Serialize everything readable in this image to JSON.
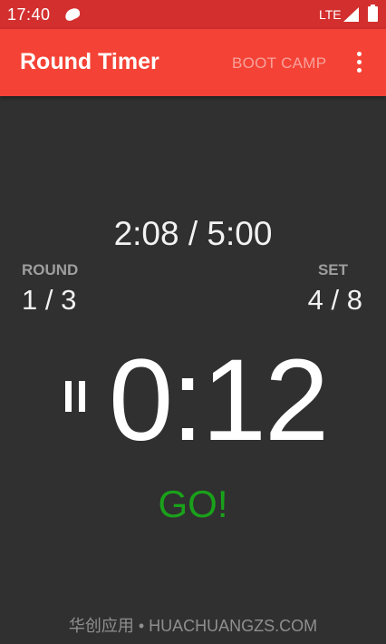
{
  "status_bar": {
    "time": "17:40",
    "network": "LTE",
    "icons": [
      "blob-icon",
      "signal-icon",
      "battery-icon"
    ],
    "background_color": "#d32f2f"
  },
  "app_bar": {
    "title": "Round Timer",
    "preset": "BOOT CAMP",
    "menu_icon": "overflow-menu-icon",
    "background_color": "#f44336"
  },
  "timer": {
    "elapsed": "2:08 / 5:00",
    "round_label": "ROUND",
    "round_value": "1 / 3",
    "set_label": "SET",
    "set_value": "4 / 8",
    "countdown": "0:12",
    "state_text": "GO!",
    "state_color": "#1aa11a",
    "pause_icon": "pause-icon"
  },
  "watermark": {
    "text": "华创应用 • HUACHUANGZS.COM"
  }
}
